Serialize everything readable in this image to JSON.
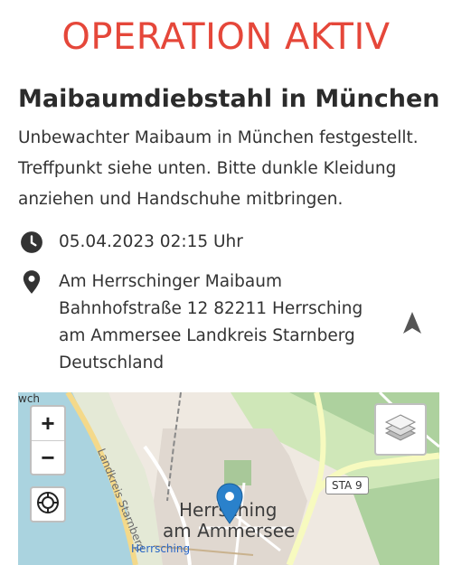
{
  "header": {
    "status_banner": "OPERATION AKTIV"
  },
  "operation": {
    "title": "Maibaumdiebstahl in München",
    "description": "Unbewachter Maibaum in München festgestellt. Treffpunkt siehe unten. Bitte dunkle Kleidung anziehen und Handschuhe mitbringen.",
    "datetime": "05.04.2023 02:15 Uhr",
    "address_lines": [
      "Am Herrschinger Maibaum",
      "Bahnhofstraße 12 82211 Herrsching",
      "am Ammersee Landkreis Starnberg",
      "Deutschland"
    ]
  },
  "map": {
    "zoom_in_label": "+",
    "zoom_out_label": "−",
    "labels": {
      "town_line1": "Herrsching",
      "town_line2": "am Ammersee",
      "small_town": "Herrsching",
      "road": "Landkreis Starnberg",
      "shield": "STA 9",
      "corner": "wch"
    }
  },
  "colors": {
    "banner": "#e5473a",
    "text": "#333333",
    "icon": "#333333",
    "marker": "#2a81cb",
    "water": "#aad3df",
    "forest": "#add19e",
    "road_yellow": "#f7fabf"
  },
  "icons": [
    "clock-icon",
    "location-pin-icon",
    "navigation-arrow-icon",
    "layers-icon",
    "locate-icon",
    "map-marker-icon"
  ]
}
